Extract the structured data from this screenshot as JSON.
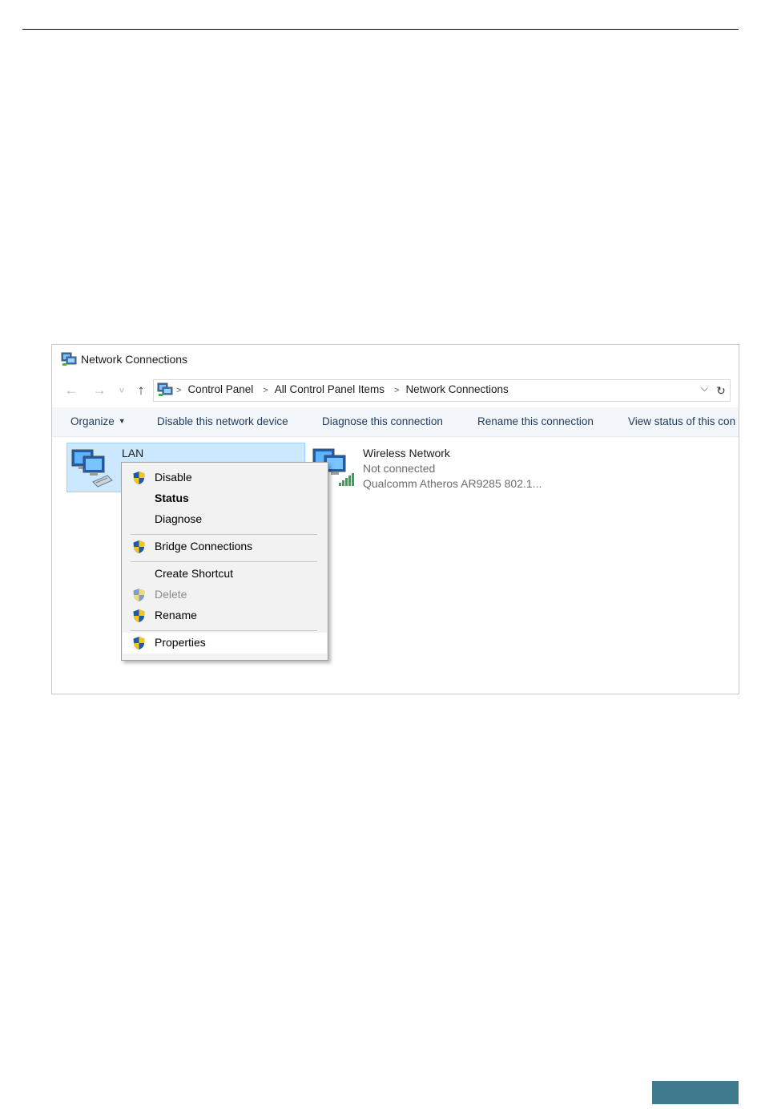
{
  "window": {
    "title": "Network Connections",
    "breadcrumbs": [
      "Control Panel",
      "All Control Panel Items",
      "Network Connections"
    ]
  },
  "nav": {
    "back": "←",
    "forward": "→",
    "recent": "˅",
    "up": "↑",
    "dropdown": "⌵",
    "refresh": "↻"
  },
  "commands": {
    "organize": "Organize",
    "disable": "Disable this network device",
    "diagnose": "Diagnose this connection",
    "rename": "Rename this connection",
    "view_status": "View status of this con"
  },
  "items": {
    "lan": {
      "name": "LAN",
      "icon": "wired-network-adapter-icon"
    },
    "wireless": {
      "name": "Wireless Network",
      "status": "Not connected",
      "adapter": "Qualcomm Atheros AR9285 802.1...",
      "icon": "wireless-network-adapter-icon"
    }
  },
  "context_menu": {
    "items": [
      {
        "label": "Disable",
        "shield": true
      },
      {
        "label": "Status",
        "bold": true
      },
      {
        "label": "Diagnose"
      },
      {
        "label": "Bridge Connections",
        "shield": true
      },
      {
        "label": "Create Shortcut"
      },
      {
        "label": "Delete",
        "shield": true,
        "disabled": true
      },
      {
        "label": "Rename",
        "shield": true
      },
      {
        "label": "Properties",
        "shield": true,
        "highlighted": true
      }
    ]
  },
  "colors": {
    "selection_bg": "#cce8ff",
    "command_text": "#1e3a5a",
    "footer_accent": "#3f7b8f",
    "shield_blue": "#1f5aa8",
    "shield_yellow": "#f5c518"
  }
}
